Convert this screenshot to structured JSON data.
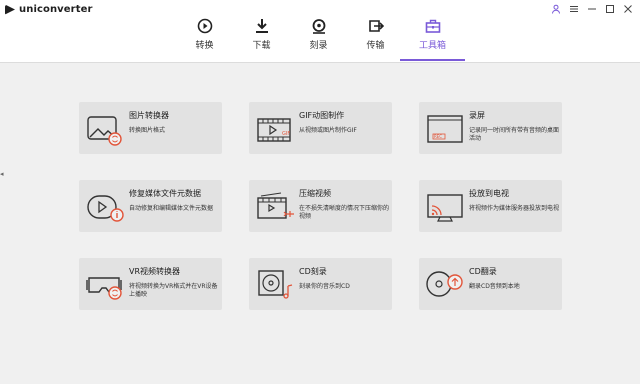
{
  "app": {
    "name": "uniconverter"
  },
  "window_controls": [
    "user-icon",
    "menu-icon",
    "minimize-icon",
    "maximize-icon",
    "close-icon"
  ],
  "nav": [
    {
      "label": "转换",
      "icon": "convert-icon"
    },
    {
      "label": "下载",
      "icon": "download-icon"
    },
    {
      "label": "刻录",
      "icon": "burn-icon"
    },
    {
      "label": "传输",
      "icon": "transfer-icon"
    },
    {
      "label": "工具箱",
      "icon": "toolbox-icon",
      "active": true
    }
  ],
  "tools": [
    {
      "title": "图片转换器",
      "desc": "转换图片格式",
      "icon": "image-converter-icon"
    },
    {
      "title": "GIF动图制作",
      "desc": "从视频或图片制作GIF",
      "icon": "gif-maker-icon"
    },
    {
      "title": "录屏",
      "desc": "记录同一时间所有带有音频的桌面活动",
      "icon": "screen-recorder-icon"
    },
    {
      "title": "修复媒体文件元数据",
      "desc": "自动修复和编辑媒体文件元数据",
      "icon": "fix-metadata-icon"
    },
    {
      "title": "压缩视频",
      "desc": "在不损失清晰度的情况下压缩你的视频",
      "icon": "compress-video-icon"
    },
    {
      "title": "投放到电视",
      "desc": "将视频作为媒体服务器投放到电视",
      "icon": "cast-to-tv-icon"
    },
    {
      "title": "VR视频转换器",
      "desc": "将视频转换为VR格式并在VR设备上播映",
      "icon": "vr-converter-icon"
    },
    {
      "title": "CD刻录",
      "desc": "刻录你的音乐到CD",
      "icon": "cd-burner-icon"
    },
    {
      "title": "CD翻录",
      "desc": "翻录CD音频到本地",
      "icon": "cd-ripper-icon"
    }
  ],
  "colors": {
    "accent": "#7a5ad8",
    "badge": "#e2553a"
  }
}
